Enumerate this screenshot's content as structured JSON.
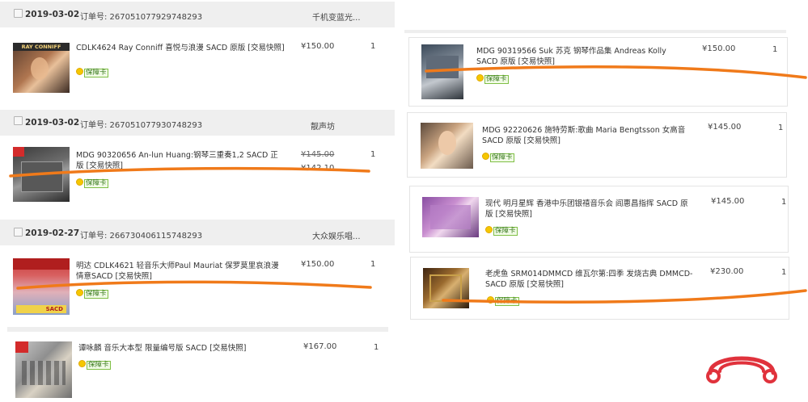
{
  "badge_label": "保障卡",
  "left": {
    "orders": [
      {
        "date": "2019-03-02",
        "order_no": "订单号: 267051077929748293",
        "shop": "千机变蓝光...",
        "items": [
          {
            "title": "CDLK4624 Ray Conniff 喜悦与浪漫 SACD 原版 [交易快照]",
            "price": "¥150.00",
            "qty": "1",
            "cover_text": "RAY CONNIFF"
          }
        ]
      },
      {
        "date": "2019-03-02",
        "order_no": "订单号: 267051077930748293",
        "shop": "靓声坊",
        "items": [
          {
            "title": "MDG 90320656 An-lun Huang:钢琴三重奏1,2 SACD 正版 [交易快照]",
            "price_original": "¥145.00",
            "price": "¥142.10",
            "qty": "1"
          }
        ]
      },
      {
        "date": "2019-02-27",
        "order_no": "订单号: 266730406115748293",
        "shop": "大众娱乐唱...",
        "items": [
          {
            "title": "明达 CDLK4621 轻音乐大师Paul Mauriat 保罗莫里哀浪漫情意SACD [交易快照]",
            "price": "¥150.00",
            "qty": "1",
            "cover_text": "SACD"
          }
        ]
      }
    ],
    "tail_item": {
      "title": "谭咏麟 音乐大本型 限量编号版 SACD [交易快照]",
      "price": "¥167.00",
      "qty": "1"
    }
  },
  "right": {
    "items": [
      {
        "title": "MDG 90319566 Suk 苏克 钢琴作品集 Andreas Kolly SACD 原版 [交易快照]",
        "price": "¥150.00",
        "qty": "1"
      },
      {
        "title": "MDG 92220626 施特劳斯:歌曲 Maria Bengtsson 女高音 SACD 原版 [交易快照]",
        "price": "¥145.00",
        "qty": "1"
      },
      {
        "title": "现代 明月星辉 香港中乐团银禧音乐会 阎惠昌指挥 SACD 原版 [交易快照]",
        "price": "¥145.00",
        "qty": "1"
      },
      {
        "title": "老虎鱼 SRM014DMMCD 维瓦尔第:四季 发烧古典 DMMCD-SACD 原版 [交易快照]",
        "price": "¥230.00",
        "qty": "1"
      }
    ]
  },
  "colors": {
    "annotation_stroke": "#f07a1a",
    "header_bg": "#efefef",
    "logo_red": "#e0323c"
  },
  "logo_icon": "headphones-icon"
}
